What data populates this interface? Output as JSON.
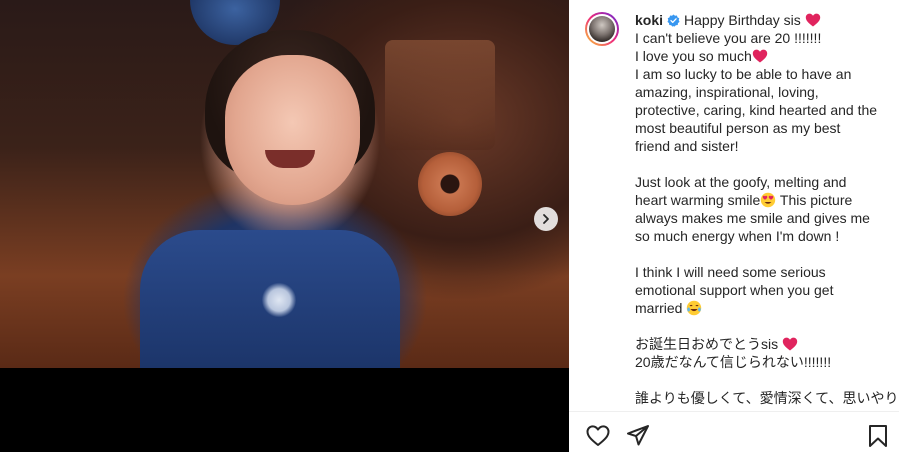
{
  "post": {
    "username": "koki",
    "caption_lines": [
      {
        "text": "Happy Birthday sis",
        "emoji": "heart"
      },
      {
        "text": "I can't believe you are 20 !!!!!!!"
      },
      {
        "text": "I love you so much",
        "emoji": "heart"
      },
      {
        "text": "I am so lucky to be able to have an"
      },
      {
        "text": "amazing, inspirational, loving,"
      },
      {
        "text": "protective, caring, kind hearted and the"
      },
      {
        "text": "most beautiful person as my best"
      },
      {
        "text": "friend and sister!"
      },
      {
        "gap": true
      },
      {
        "text": "Just look at the goofy, melting and"
      },
      {
        "text": "heart warming smile",
        "emoji": "heart-eyes",
        "after": " This picture"
      },
      {
        "text": "always makes me smile and gives me"
      },
      {
        "text": "so much energy when I'm down !"
      },
      {
        "gap": true
      },
      {
        "text": "I think I will need some serious"
      },
      {
        "text": "emotional support when you get"
      },
      {
        "text": "married ",
        "emoji": "tears-of-joy"
      },
      {
        "gap": true
      },
      {
        "text": "お誕生日おめでとうsis",
        "emoji": "heart"
      },
      {
        "text": "20歳だなんて信じられない!!!!!!!"
      },
      {
        "gap": true
      },
      {
        "text": "誰よりも優しくて、愛情深くて、思いやり"
      }
    ]
  },
  "icons": {
    "verified": "verified-badge-icon",
    "next": "chevron-right-icon",
    "like": "heart-outline-icon",
    "share": "paper-plane-icon",
    "save": "bookmark-icon"
  },
  "colors": {
    "text": "#262626",
    "verified": "#3897f0",
    "heart": "#e0245e",
    "border": "#efefef"
  }
}
